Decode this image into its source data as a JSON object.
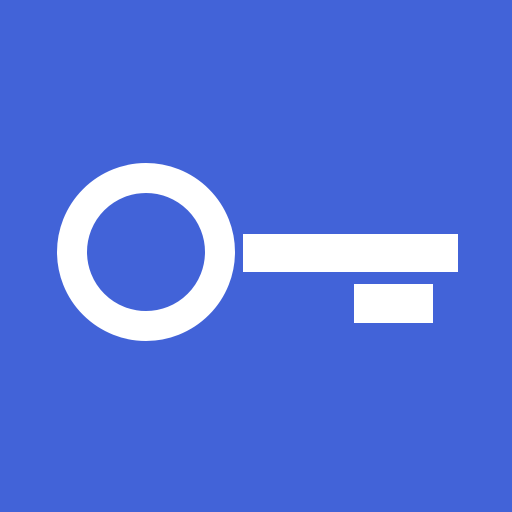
{
  "app_icon": {
    "icon": "key-icon",
    "background_color": "#4263D8",
    "foreground_color": "#FFFFFF"
  }
}
